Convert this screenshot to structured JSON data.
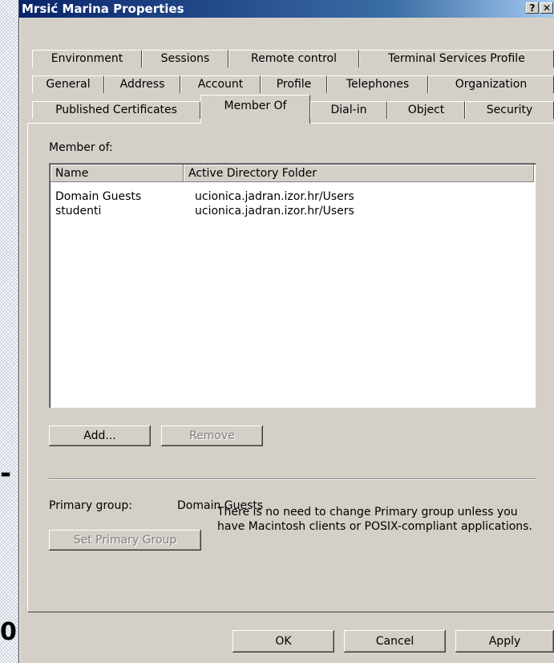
{
  "window": {
    "title": "Mrsić Marina Properties",
    "help_btn": "?",
    "close_btn": "✕"
  },
  "background": {
    "dash": "-",
    "number": "0"
  },
  "tabs": {
    "row1": [
      "Environment",
      "Sessions",
      "Remote control",
      "Terminal Services Profile"
    ],
    "row2": [
      "General",
      "Address",
      "Account",
      "Profile",
      "Telephones",
      "Organization"
    ],
    "row3": [
      "Published Certificates",
      "Member Of",
      "Dial-in",
      "Object",
      "Security"
    ],
    "active": "Member Of"
  },
  "member_of": {
    "label": "Member of:",
    "columns": [
      "Name",
      "Active Directory Folder"
    ],
    "rows": [
      {
        "name": "Domain Guests",
        "folder": "ucionica.jadran.izor.hr/Users"
      },
      {
        "name": "studenti",
        "folder": "ucionica.jadran.izor.hr/Users"
      }
    ],
    "add_label": "Add...",
    "remove_label": "Remove"
  },
  "primary_group": {
    "label": "Primary group:",
    "value": "Domain Guests",
    "set_button": "Set Primary Group",
    "info": "There is no need to change Primary group unless you have Macintosh clients or POSIX-compliant applications."
  },
  "footer": {
    "ok": "OK",
    "cancel": "Cancel",
    "apply": "Apply"
  }
}
